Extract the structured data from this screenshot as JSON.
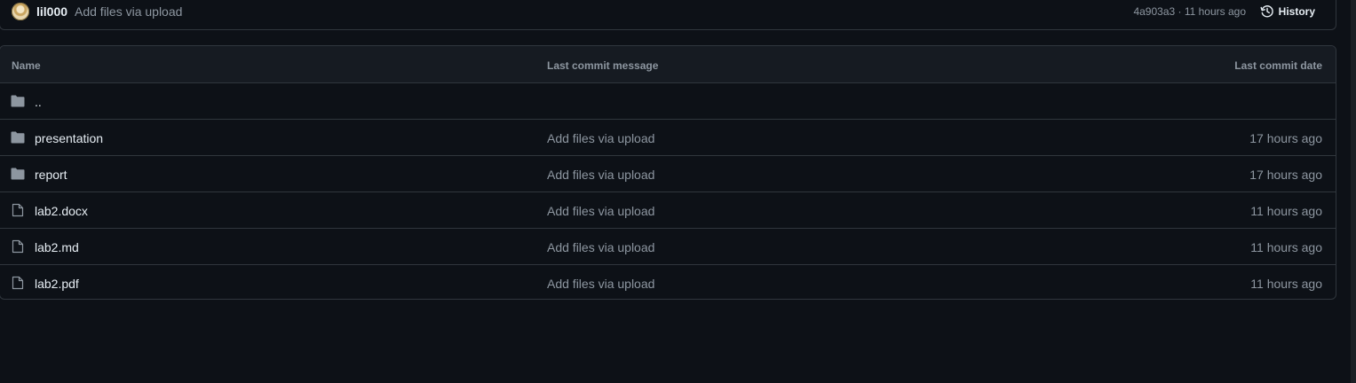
{
  "commit": {
    "author": "lil000",
    "message": "Add files via upload",
    "meta": "4a903a3 · 11 hours ago",
    "history_label": "History",
    "avatar_icon": "user-avatar"
  },
  "table": {
    "headers": {
      "name": "Name",
      "message": "Last commit message",
      "date": "Last commit date"
    },
    "rows": [
      {
        "name": "..",
        "icon": "folder-icon",
        "message": "",
        "date": ""
      },
      {
        "name": "presentation",
        "icon": "folder-icon",
        "message": "Add files via upload",
        "date": "17 hours ago"
      },
      {
        "name": "report",
        "icon": "folder-icon",
        "message": "Add files via upload",
        "date": "17 hours ago"
      },
      {
        "name": "lab2.docx",
        "icon": "file-icon",
        "message": "Add files via upload",
        "date": "11 hours ago"
      },
      {
        "name": "lab2.md",
        "icon": "file-icon",
        "message": "Add files via upload",
        "date": "11 hours ago"
      },
      {
        "name": "lab2.pdf",
        "icon": "file-icon",
        "message": "Add files via upload",
        "date": "11 hours ago"
      }
    ]
  },
  "colors": {
    "background": "#0d1117",
    "header_background": "#161b22",
    "border": "#30363d",
    "text_primary": "#e6edf3",
    "text_muted": "#8d96a0",
    "icon": "#8d96a0"
  }
}
